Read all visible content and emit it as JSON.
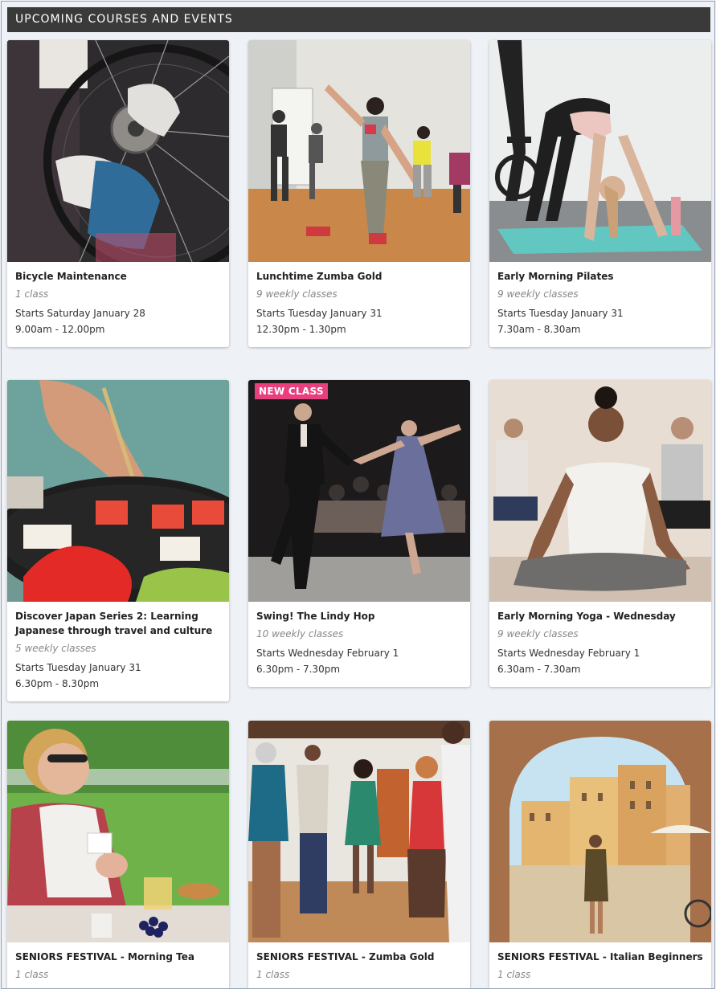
{
  "header": {
    "title": "UPCOMING COURSES AND EVENTS"
  },
  "courses": [
    {
      "title": "Bicycle Maintenance",
      "sessions": "1 class",
      "starts": "Starts Saturday January 28",
      "time": "9.00am - 12.00pm"
    },
    {
      "title": "Lunchtime Zumba Gold",
      "sessions": "9 weekly classes",
      "starts": "Starts Tuesday January 31",
      "time": "12.30pm - 1.30pm"
    },
    {
      "title": "Early Morning Pilates",
      "sessions": "9 weekly classes",
      "starts": "Starts Tuesday January 31",
      "time": "7.30am - 8.30am"
    },
    {
      "title": "Discover Japan Series 2: Learning Japanese through travel and culture",
      "sessions": "5 weekly classes",
      "starts": "Starts Tuesday January 31",
      "time": "6.30pm - 8.30pm"
    },
    {
      "title": "Swing! The Lindy Hop",
      "sessions": "10 weekly classes",
      "starts": "Starts Wednesday February 1",
      "time": "6.30pm - 7.30pm",
      "badge": "NEW CLASS"
    },
    {
      "title": "Early Morning Yoga - Wednesday",
      "sessions": "9 weekly classes",
      "starts": "Starts Wednesday February 1",
      "time": "6.30am - 7.30am"
    },
    {
      "title": "SENIORS FESTIVAL - Morning Tea",
      "sessions": "1 class",
      "starts": "",
      "time": ""
    },
    {
      "title": "SENIORS FESTIVAL - Zumba Gold",
      "sessions": "1 class",
      "starts": "",
      "time": ""
    },
    {
      "title": "SENIORS FESTIVAL - Italian Beginners",
      "sessions": "1 class",
      "starts": "",
      "time": ""
    }
  ],
  "colors": {
    "header_bg": "#3a3a3a",
    "badge_bg": "#e8407f",
    "page_bg": "#eef1f5"
  }
}
